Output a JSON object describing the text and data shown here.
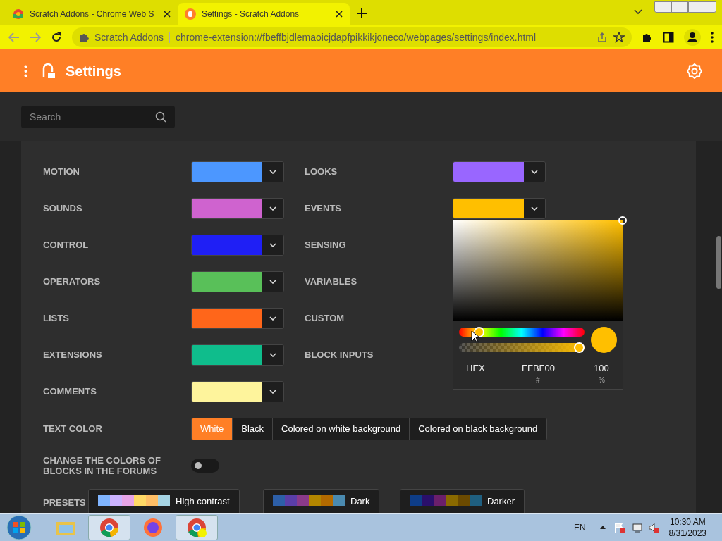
{
  "browser": {
    "tabs": [
      {
        "title": "Scratch Addons - Chrome Web S",
        "selected": false
      },
      {
        "title": "Settings - Scratch Addons",
        "selected": true
      }
    ],
    "site_chip": "Scratch Addons",
    "url": "chrome-extension://fbeffbjdlemaoicjdapfpikkikjoneco/webpages/settings/index.html"
  },
  "header": {
    "title": "Settings"
  },
  "search": {
    "placeholder": "Search"
  },
  "categories": [
    {
      "label": "MOTION",
      "color": "#4c97ff"
    },
    {
      "label": "LOOKS",
      "color": "#9966ff"
    },
    {
      "label": "SOUNDS",
      "color": "#cf63cf"
    },
    {
      "label": "EVENTS",
      "color": "#ffbf00"
    },
    {
      "label": "CONTROL",
      "color": "#1f1ff5"
    },
    {
      "label": "SENSING"
    },
    {
      "label": "OPERATORS",
      "color": "#59c059"
    },
    {
      "label": "VARIABLES"
    },
    {
      "label": "LISTS",
      "color": "#ff661a"
    },
    {
      "label": "CUSTOM"
    },
    {
      "label": "EXTENSIONS",
      "color": "#0fbd8c"
    },
    {
      "label": "BLOCK INPUTS"
    },
    {
      "label": "COMMENTS",
      "color": "#fef49c"
    }
  ],
  "color_picker": {
    "color": "#ffbf00",
    "hue": {
      "level": 0.13
    },
    "alpha": {
      "level": 1
    },
    "mode": "HEX",
    "hex": "FFBF00",
    "hex_unit": "#",
    "alpha_value": "100",
    "alpha_unit": "%"
  },
  "text_color": {
    "label": "TEXT COLOR",
    "options": [
      {
        "label": "White",
        "selected": true
      },
      {
        "label": "Black",
        "selected": false
      },
      {
        "label": "Colored on white background",
        "selected": false
      },
      {
        "label": "Colored on black background",
        "selected": false
      }
    ]
  },
  "forums_toggle": {
    "label": "CHANGE THE COLORS OF BLOCKS IN THE FORUMS",
    "on": false
  },
  "presets": {
    "label": "PRESETS",
    "items": [
      {
        "name": "High contrast",
        "swatches": [
          {
            "color": "#80b5ff"
          },
          {
            "color": "#ccb3ff"
          },
          {
            "color": "#e7a4e7"
          },
          {
            "color": "#ffd966"
          },
          {
            "color": "#ffbf66"
          },
          {
            "color": "#a6d4e4"
          }
        ]
      },
      {
        "name": "Dark",
        "swatches": [
          {
            "color": "#2d5fa8"
          },
          {
            "color": "#5a3ea8"
          },
          {
            "color": "#8a3a8a"
          },
          {
            "color": "#b38600"
          },
          {
            "color": "#b36a00"
          },
          {
            "color": "#4a8ab0"
          }
        ]
      },
      {
        "name": "Darker",
        "swatches": [
          {
            "color": "#0e3d87"
          },
          {
            "color": "#2a0f6b"
          },
          {
            "color": "#6b1f6b"
          },
          {
            "color": "#8a6a00"
          },
          {
            "color": "#6b4a00"
          },
          {
            "color": "#1f5f80"
          }
        ]
      }
    ]
  },
  "taskbar": {
    "language": "EN",
    "time": "10:30 AM",
    "date": "8/31/2023"
  }
}
